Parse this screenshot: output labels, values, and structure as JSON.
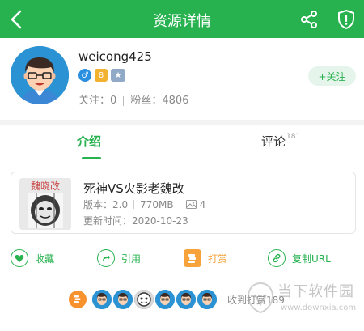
{
  "header": {
    "title": "资源详情"
  },
  "profile": {
    "username": "weicong425",
    "following_label": "关注",
    "following_count": "0",
    "followers_label": "粉丝",
    "followers_count": "4806",
    "follow_button": "+关注",
    "badges": [
      "male-icon",
      "coin-badge-icon",
      "rank-badge-icon"
    ]
  },
  "tabs": {
    "intro": "介绍",
    "comments": "评论",
    "comments_count": "181"
  },
  "resource": {
    "title": "死神VS火影老魏改",
    "thumb_text": "魏晓改",
    "version_label": "版本：2.0",
    "size": "770MB",
    "image_count": "4",
    "update_label": "更新时间：2020-10-23"
  },
  "actions": {
    "favorite": "收藏",
    "cite": "引用",
    "tip": "打赏",
    "copy_url": "复制URL"
  },
  "tippers": {
    "text": "收到打赏189"
  },
  "watermark": {
    "title": "当下软件园",
    "url": "www.downxia.com"
  },
  "colors": {
    "brand": "#27b24f",
    "accent_orange": "#f7a23b"
  }
}
